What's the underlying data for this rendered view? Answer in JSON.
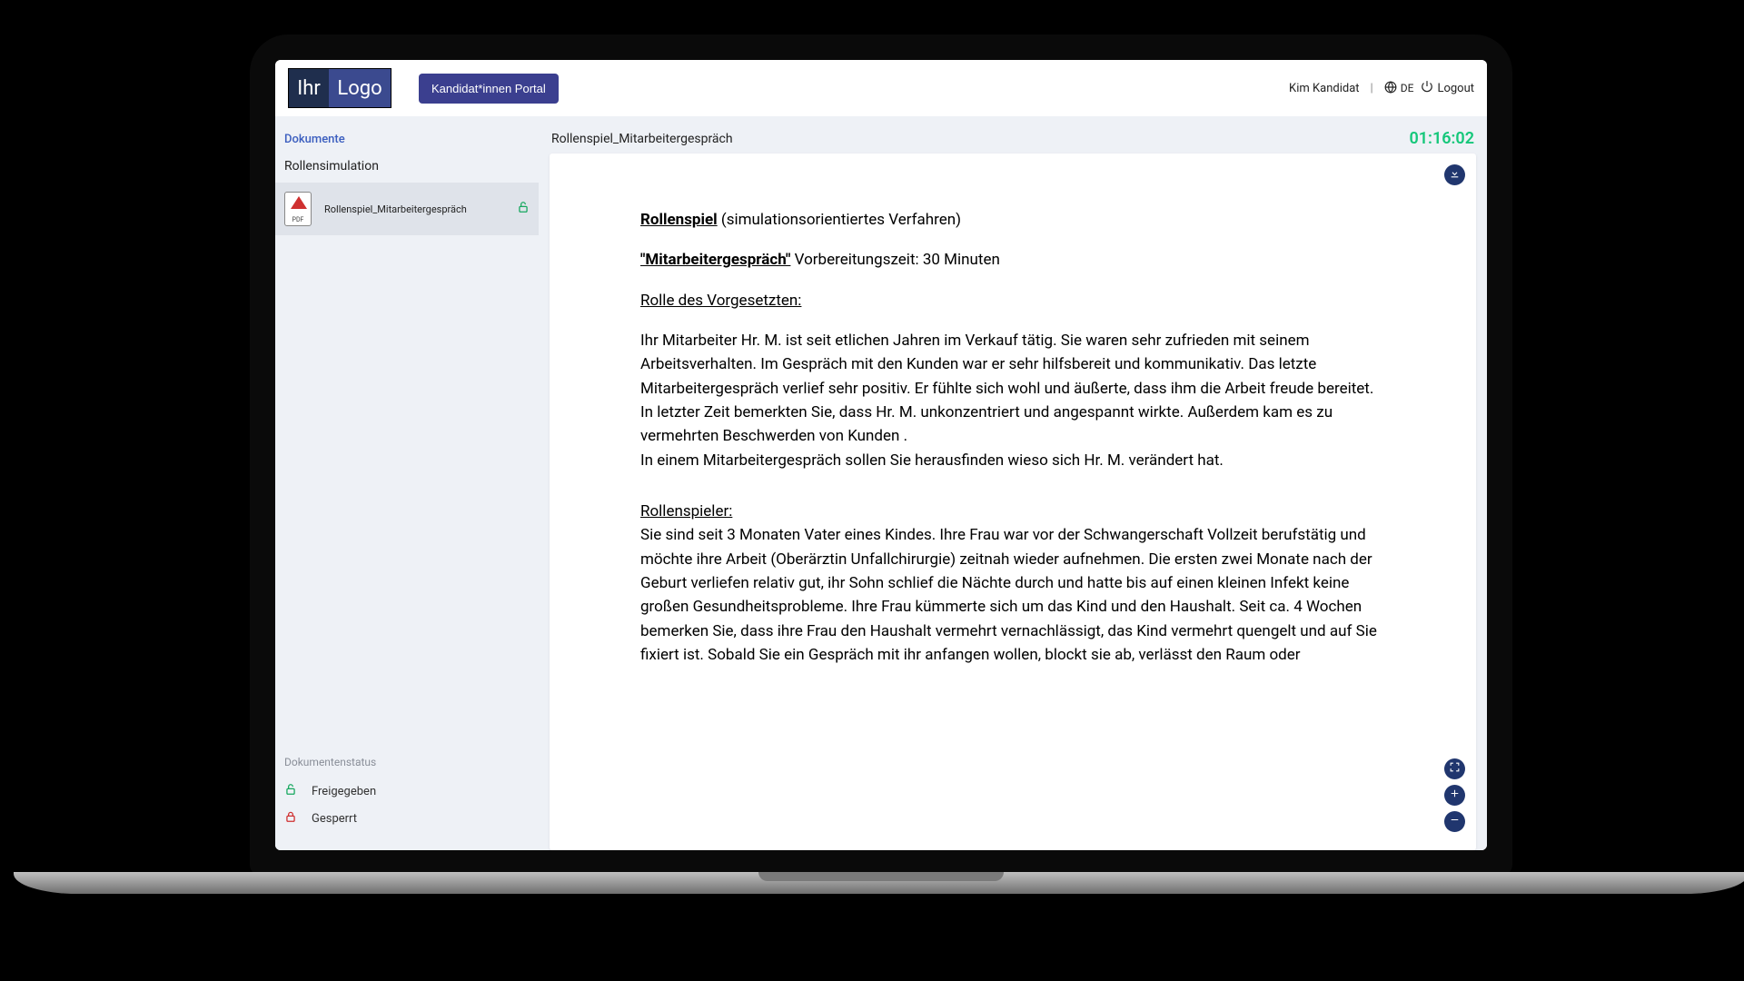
{
  "header": {
    "logo_left": "Ihr",
    "logo_right": "Logo",
    "portal_button": "Kandidat*innen Portal",
    "user_name": "Kim Kandidat",
    "language_code": "DE",
    "logout_label": "Logout"
  },
  "sidebar": {
    "documents_label": "Dokumente",
    "simulation_label": "Rollensimulation",
    "items": [
      {
        "name": "Rollenspiel_Mitarbeitergespräch",
        "locked": false
      }
    ],
    "status_heading": "Dokumentenstatus",
    "legend_open": "Freigegeben",
    "legend_locked": "Gesperrt"
  },
  "content": {
    "title": "Rollenspiel_Mitarbeitergespräch",
    "timer": "01:16:02"
  },
  "document": {
    "heading_bold": "Rollenspiel",
    "heading_rest": " (simulationsorientiertes Verfahren)",
    "sub_bold": "\"Mitarbeitergespräch\"",
    "sub_rest": " Vorbereitungszeit: 30 Minuten",
    "role_label": "Rolle des Vorgesetzten:",
    "para1": "Ihr Mitarbeiter Hr. M. ist seit etlichen Jahren im Verkauf tätig. Sie waren sehr zufrieden mit seinem Arbeitsverhalten. Im Gespräch mit den Kunden war er sehr hilfsbereit und kommunikativ. Das letzte Mitarbeitergespräch verlief sehr positiv. Er fühlte sich wohl und äußerte, dass ihm die Arbeit freude bereitet. In letzter Zeit bemerkten Sie, dass Hr. M. unkonzentriert und angespannt wirkte. Außerdem kam es zu vermehrten Beschwerden von Kunden .",
    "para1b": "In einem Mitarbeitergespräch sollen Sie herausfinden wieso sich Hr. M. verändert hat.",
    "role2_label": "Rollenspieler:",
    "para2": "Sie sind seit 3 Monaten Vater eines Kindes. Ihre Frau war vor der Schwangerschaft Vollzeit berufstätig und möchte ihre Arbeit (Oberärztin Unfallchirurgie) zeitnah wieder aufnehmen. Die ersten zwei Monate nach der Geburt verliefen relativ gut, ihr Sohn schlief die Nächte durch und hatte bis auf einen kleinen Infekt keine großen Gesundheitsprobleme. Ihre Frau kümmerte sich um das Kind und den Haushalt. Seit ca. 4 Wochen bemerken Sie, dass ihre Frau den Haushalt vermehrt vernachlässigt, das Kind vermehrt quengelt und auf Sie fixiert ist. Sobald Sie ein Gespräch mit ihr anfangen wollen, blockt sie ab, verlässt den Raum oder"
  }
}
